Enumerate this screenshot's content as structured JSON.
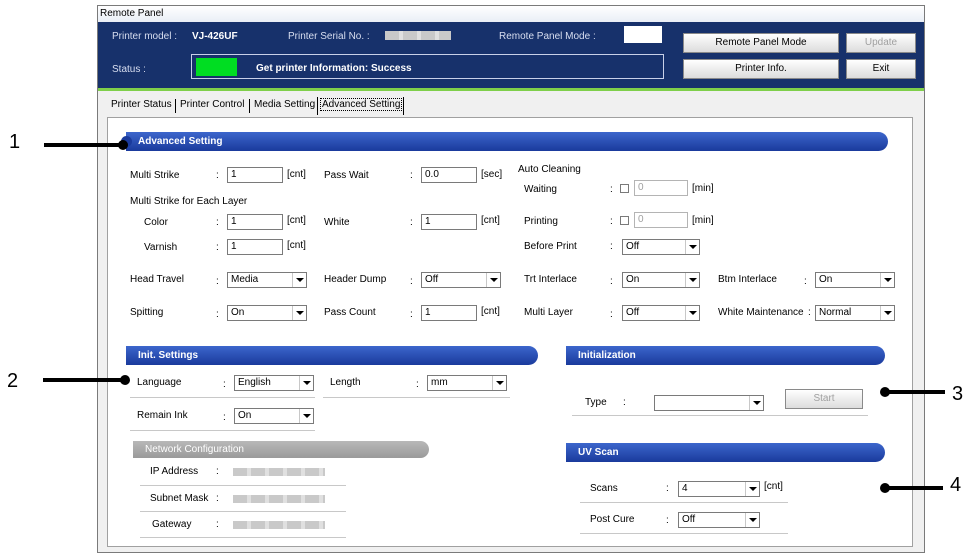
{
  "window_title": "Remote Panel",
  "header": {
    "printer_model_label": "Printer model :",
    "printer_model": "VJ-426UF",
    "serial_label": "Printer Serial No. :",
    "mode_label": "Remote Panel Mode :",
    "status_label": "Status :",
    "status_text": "Get printer Information: Success",
    "status_color": "#00dd22"
  },
  "buttons": {
    "remote_panel_mode": "Remote Panel Mode",
    "update": "Update",
    "printer_info": "Printer Info.",
    "exit": "Exit"
  },
  "tabs": [
    "Printer Status",
    "Printer Control",
    "Media Setting",
    "Advanced Setting"
  ],
  "advanced": {
    "title": "Advanced Setting",
    "multi_strike": {
      "label": "Multi Strike",
      "value": "1",
      "unit": "[cnt]"
    },
    "pass_wait": {
      "label": "Pass Wait",
      "value": "0.0",
      "unit": "[sec]"
    },
    "auto_cleaning": "Auto Cleaning",
    "waiting": {
      "label": "Waiting",
      "value": "0",
      "unit": "[min]"
    },
    "mse_layer": "Multi Strike for Each Layer",
    "color": {
      "label": "Color",
      "value": "1",
      "unit": "[cnt]"
    },
    "white": {
      "label": "White",
      "value": "1",
      "unit": "[cnt]"
    },
    "printing": {
      "label": "Printing",
      "value": "0",
      "unit": "[min]"
    },
    "varnish": {
      "label": "Varnish",
      "value": "1",
      "unit": "[cnt]"
    },
    "before_print": {
      "label": "Before Print",
      "value": "Off"
    },
    "head_travel": {
      "label": "Head Travel",
      "value": "Media"
    },
    "header_dump": {
      "label": "Header Dump",
      "value": "Off"
    },
    "trt_interlace": {
      "label": "Trt Interlace",
      "value": "On"
    },
    "btm_interlace": {
      "label": "Btm Interlace",
      "value": "On"
    },
    "spitting": {
      "label": "Spitting",
      "value": "On"
    },
    "pass_count": {
      "label": "Pass Count",
      "value": "1",
      "unit": "[cnt]"
    },
    "multi_layer": {
      "label": "Multi Layer",
      "value": "Off"
    },
    "white_maint": {
      "label": "White Maintenance",
      "value": "Normal"
    }
  },
  "init": {
    "title": "Init. Settings",
    "language": {
      "label": "Language",
      "value": "English"
    },
    "length": {
      "label": "Length",
      "value": "mm"
    },
    "remain_ink": {
      "label": "Remain Ink",
      "value": "On"
    }
  },
  "network": {
    "title": "Network Configuration",
    "ip": "IP Address",
    "subnet": "Subnet Mask",
    "gateway": "Gateway"
  },
  "initialization": {
    "title": "Initialization",
    "type_label": "Type",
    "type_value": "",
    "start": "Start"
  },
  "uv_scan": {
    "title": "UV Scan",
    "scans": {
      "label": "Scans",
      "value": "4",
      "unit": "[cnt]"
    },
    "post_cure": {
      "label": "Post Cure",
      "value": "Off"
    }
  },
  "callouts": [
    "1",
    "2",
    "3",
    "4"
  ],
  "colon": ":"
}
